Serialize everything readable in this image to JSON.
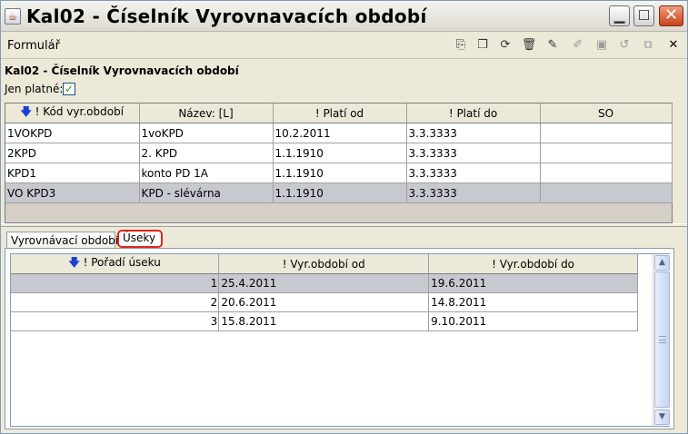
{
  "window": {
    "title": "Kal02 - Číselník Vyrovnavacích období",
    "app_icon": "java-icon",
    "buttons": {
      "minimize": "▁",
      "maximize": "☐",
      "close": "✕"
    }
  },
  "menu": {
    "label": "Formulář",
    "toolbar": [
      {
        "icon": "new-record-icon",
        "glyph": "⎘",
        "enabled": true
      },
      {
        "icon": "copy-icon",
        "glyph": "❐",
        "enabled": true
      },
      {
        "icon": "refresh-icon",
        "glyph": "⟳",
        "enabled": true
      },
      {
        "icon": "delete-icon",
        "glyph": "🗑",
        "enabled": true
      },
      {
        "icon": "edit-icon",
        "glyph": "✎",
        "enabled": true
      },
      {
        "icon": "post-icon",
        "glyph": "✐",
        "enabled": false
      },
      {
        "icon": "save-icon",
        "glyph": "▣",
        "enabled": false
      },
      {
        "icon": "undo-icon",
        "glyph": "↺",
        "enabled": false
      },
      {
        "icon": "window-icon",
        "glyph": "⧉",
        "enabled": false
      },
      {
        "icon": "close-icon",
        "glyph": "✕",
        "enabled": true
      }
    ]
  },
  "form": {
    "title": "Kal02 - Číselník Vyrovnavacích období",
    "filter_label": "Jen platné:",
    "filter_checked": "✓"
  },
  "grid1": {
    "sort_arrow": "🡇",
    "columns": [
      "! Kód vyr.období",
      "Název: [L]",
      "! Platí od",
      "! Platí do",
      "SO"
    ],
    "rows": [
      [
        "1VOKPD",
        "1voKPD",
        "10.2.2011",
        "3.3.3333",
        ""
      ],
      [
        "2KPD",
        "2. KPD",
        "1.1.1910",
        "3.3.3333",
        ""
      ],
      [
        "KPD1",
        "konto PD 1A",
        "1.1.1910",
        "3.3.3333",
        ""
      ],
      [
        "VO KPD3",
        "KPD - slévárna",
        "1.1.1910",
        "3.3.3333",
        ""
      ]
    ],
    "selected_row": 3
  },
  "tabs": [
    {
      "label": "Vyrovnávací období",
      "active": false
    },
    {
      "label": "Úseky",
      "active": true
    }
  ],
  "grid2": {
    "sort_arrow": "🡇",
    "columns": [
      "! Pořadí úseku",
      "! Vyr.období od",
      "! Vyr.období do"
    ],
    "rows": [
      [
        "1",
        "25.4.2011",
        "19.6.2011"
      ],
      [
        "2",
        "20.6.2011",
        "14.8.2011"
      ],
      [
        "3",
        "15.8.2011",
        "9.10.2011"
      ]
    ],
    "selected_row": 0
  },
  "scrollbar": {
    "up": "▲",
    "down": "▼"
  }
}
